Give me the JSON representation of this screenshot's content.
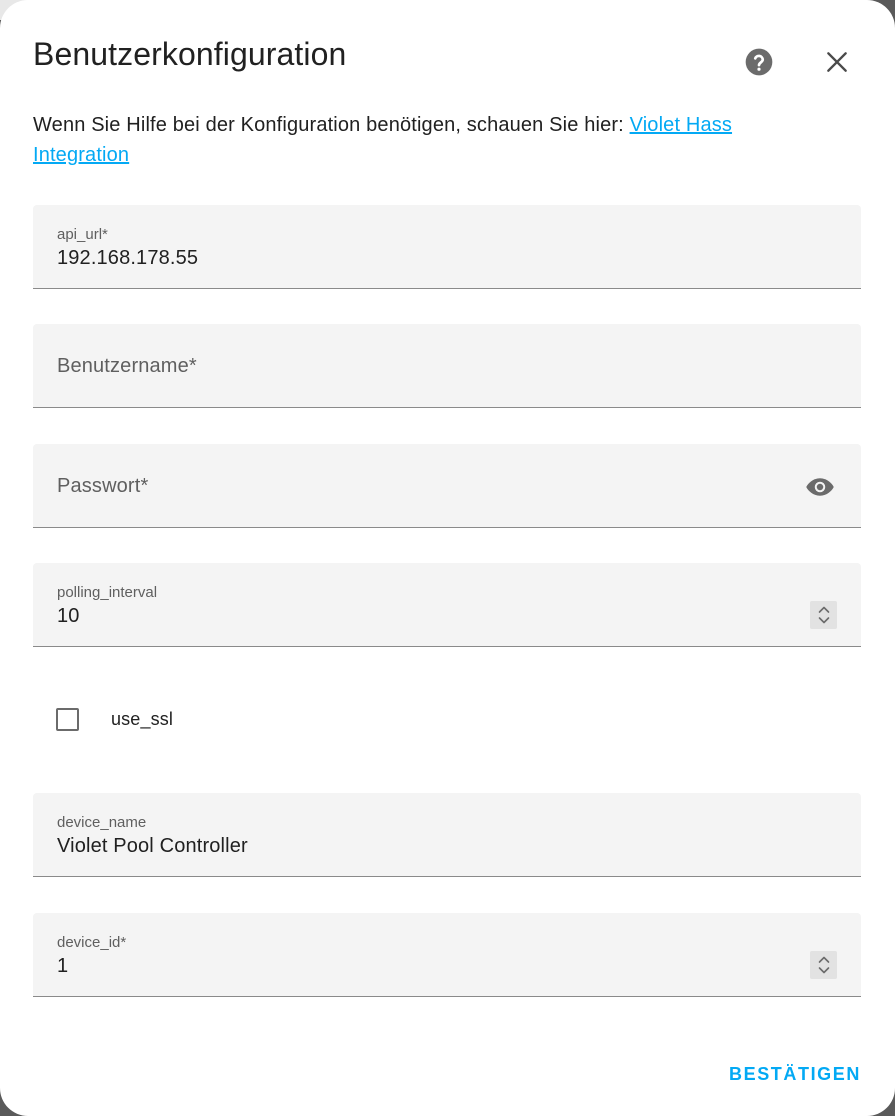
{
  "dialog": {
    "title": "Benutzerkonfiguration",
    "description_prefix": "Wenn Sie Hilfe bei der Konfiguration benötigen, schauen Sie hier: ",
    "description_link": "Violet Hass Integration",
    "help_icon": "help-circle-icon",
    "close_icon": "close-icon"
  },
  "fields": {
    "api_url": {
      "label": "api_url*",
      "value": "192.168.178.55"
    },
    "username": {
      "label": "Benutzername*",
      "value": ""
    },
    "password": {
      "label": "Passwort*",
      "value": "",
      "icon": "eye-icon"
    },
    "polling_interval": {
      "label": "polling_interval",
      "value": "10"
    },
    "use_ssl": {
      "label": "use_ssl",
      "checked": false
    },
    "device_name": {
      "label": "device_name",
      "value": "Violet Pool Controller"
    },
    "device_id": {
      "label": "device_id*",
      "value": "1"
    }
  },
  "actions": {
    "confirm_label": "BESTÄTIGEN"
  },
  "colors": {
    "accent": "#03a9f4",
    "field_bg": "#f4f4f4",
    "text": "#212121"
  }
}
